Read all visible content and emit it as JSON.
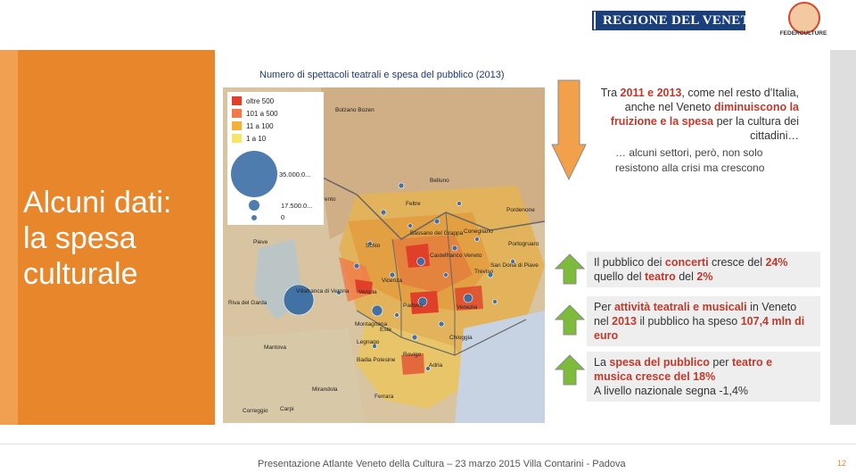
{
  "header": {
    "regione_logo_text": "REGIONE DEL VENETO",
    "federculture_label": "FEDERCULTURE"
  },
  "left_panel": {
    "title_line1": "Alcuni dati:",
    "title_line2": "la spesa",
    "title_line3": "culturale"
  },
  "map": {
    "title": "Numero di spettacoli teatrali e spesa del pubblico (2013)",
    "legend": {
      "items": [
        {
          "label": "oltre 500",
          "color": "#e0402a"
        },
        {
          "label": "101 a 500",
          "color": "#f07a4a"
        },
        {
          "label": "11 a 100",
          "color": "#f3b13a"
        },
        {
          "label": "1 a 10",
          "color": "#f5e66a"
        }
      ],
      "bubble_values": [
        "35.000.0...",
        "17.500.0...",
        "0"
      ]
    },
    "cities": [
      "Bolzano Bozen",
      "Belluno",
      "Pordenone",
      "Treviso",
      "Vicenza",
      "Padova",
      "Venezia",
      "Verona",
      "Rovigo",
      "Adria",
      "Chioggia",
      "Mantova",
      "Mirandola",
      "Carpi",
      "Correggio",
      "Ferrara",
      "Pieve",
      "Villafranca di Verona",
      "Legnago",
      "Este",
      "Schio",
      "Bassano del Grappa",
      "Castelfranco Veneto",
      "Conegliano",
      "San Donà di Piave",
      "Portogruaro",
      "Feltre",
      "Trento",
      "Riva del Garda",
      "Montagnana",
      "Badia Polesine"
    ]
  },
  "content": {
    "intro": {
      "prefix": "Tra ",
      "years": "2011 e 2013",
      "middle": ", come nel resto d'Italia, anche nel Veneto ",
      "highlight": "diminuiscono la fruizione e la spesa",
      "suffix": " per la cultura dei cittadini…"
    },
    "sub_note": "… alcuni settori, però, non solo resistono alla crisi ma crescono",
    "box1": {
      "p1": "Il pubblico dei ",
      "b1": "concerti",
      "p2": " cresce del ",
      "b2": "24%",
      "p3": " quello del ",
      "b3": "teatro",
      "p4": " del ",
      "b4": "2%"
    },
    "box2": {
      "p1": "Per ",
      "b1": "attività teatrali e musicali",
      "p2": " in Veneto nel ",
      "b2": "2013",
      "p3": " il pubblico ha speso ",
      "b3": "107,4 mln di euro"
    },
    "box3": {
      "p1": "La ",
      "b1": "spesa del pubblico",
      "p2": " per ",
      "b2": "teatro e musica cresce del 18%",
      "p3": "A livello nazionale segna -1,4%"
    }
  },
  "footer": {
    "text": "Presentazione Atlante Veneto della Cultura – 23 marzo 2015 Villa Contarini - Padova",
    "page_number": "12"
  },
  "colors": {
    "orange": "#e8862b",
    "red_highlight": "#c0392b",
    "arrow_green": "#7dbb3a",
    "arrow_orange": "#f3a04a"
  }
}
